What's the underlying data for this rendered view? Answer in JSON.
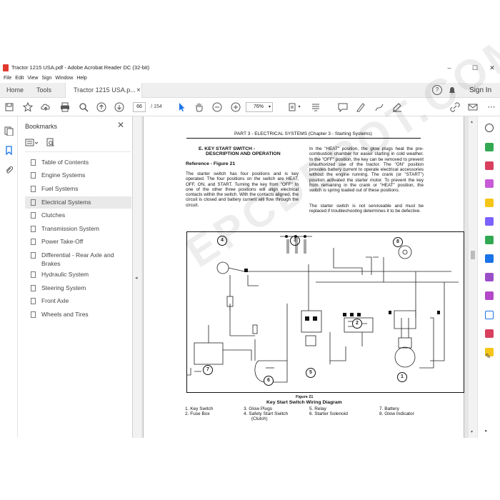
{
  "window": {
    "title": "Tractor 1215 USA.pdf - Adobe Acrobat Reader DC (32-bit)",
    "controls": [
      "–",
      "☐",
      "✕"
    ]
  },
  "menu": [
    "File",
    "Edit",
    "View",
    "Sign",
    "Window",
    "Help"
  ],
  "tabs": {
    "home": "Home",
    "tools": "Tools",
    "document": "Tractor 1215 USA.p...",
    "close": "×",
    "help": "?",
    "signin": "Sign In"
  },
  "toolbar": {
    "page_current": "66",
    "page_total": "/ 154",
    "zoom": "76%"
  },
  "bookmarks": {
    "header": "Bookmarks",
    "items": [
      {
        "label": "Table of Contents"
      },
      {
        "label": "Engine Systems"
      },
      {
        "label": "Fuel Systems"
      },
      {
        "label": "Electrical Systems",
        "selected": true
      },
      {
        "label": "Clutches"
      },
      {
        "label": "Transmission System"
      },
      {
        "label": "Power Take-Off"
      },
      {
        "label": "Differential - Rear Axle and Brakes"
      },
      {
        "label": "Hydraulic System"
      },
      {
        "label": "Steering System"
      },
      {
        "label": "Front Axle"
      },
      {
        "label": "Wheels and Tires"
      }
    ]
  },
  "document": {
    "header": "PART 3 - ELECTRICAL SYSTEMS (Chapter 3 - Starting Systems)",
    "section_title_1": "E.  KEY START SWITCH -",
    "section_title_2": "DESCRIPTION AND OPERATION",
    "reference": "Reference - Figure 21",
    "para_left": "The starter switch has four positions and is key operated. The four positions on the switch are HEAT, OFF, ON, and START. Turning the key from \"OFF\" to one of the other three positions will align electrical contacts within the switch. With the contacts aligned, the circuit is closed and battery current will flow through the circuit.",
    "para_right_1": "In the \"HEAT\" position, the glow plugs heat the pre-combustion chamber for easier starting in cold weather. In the \"OFF\" position, the key can be removed to prevent unauthorized use of the tractor. The \"ON\" position provides battery current to operate electrical accessories without the engine running. The crank (or \"START\") position activated the starter motor. To prevent the key from remaining in the crank or \"HEAT\" position, the switch is spring loaded out of these positions.",
    "para_right_2": "The starter switch is not serviceable and must be replaced if troubleshooting determines it to be defective.",
    "figure_number": "Figure 21",
    "figure_title": "Key Start Switch Wiring Diagram",
    "legend": [
      "1.   Key Switch",
      "2.   Fuse Box",
      "3.   Glow Plugs",
      "4.   Safety Start Switch",
      "      (Clutch)",
      "5.   Relay",
      "6.   Starter Solenoid",
      "7.   Battery",
      "8.   Glow Indicator"
    ],
    "diagram_callouts": [
      "1",
      "2",
      "3",
      "4",
      "5",
      "6",
      "7",
      "8"
    ],
    "watermark": "EPCDEPOT.COM"
  },
  "colors": {
    "accent_blue": "#1a73e8",
    "pdf_red": "#e03a2f",
    "selected_bg": "#e9e9e9"
  }
}
